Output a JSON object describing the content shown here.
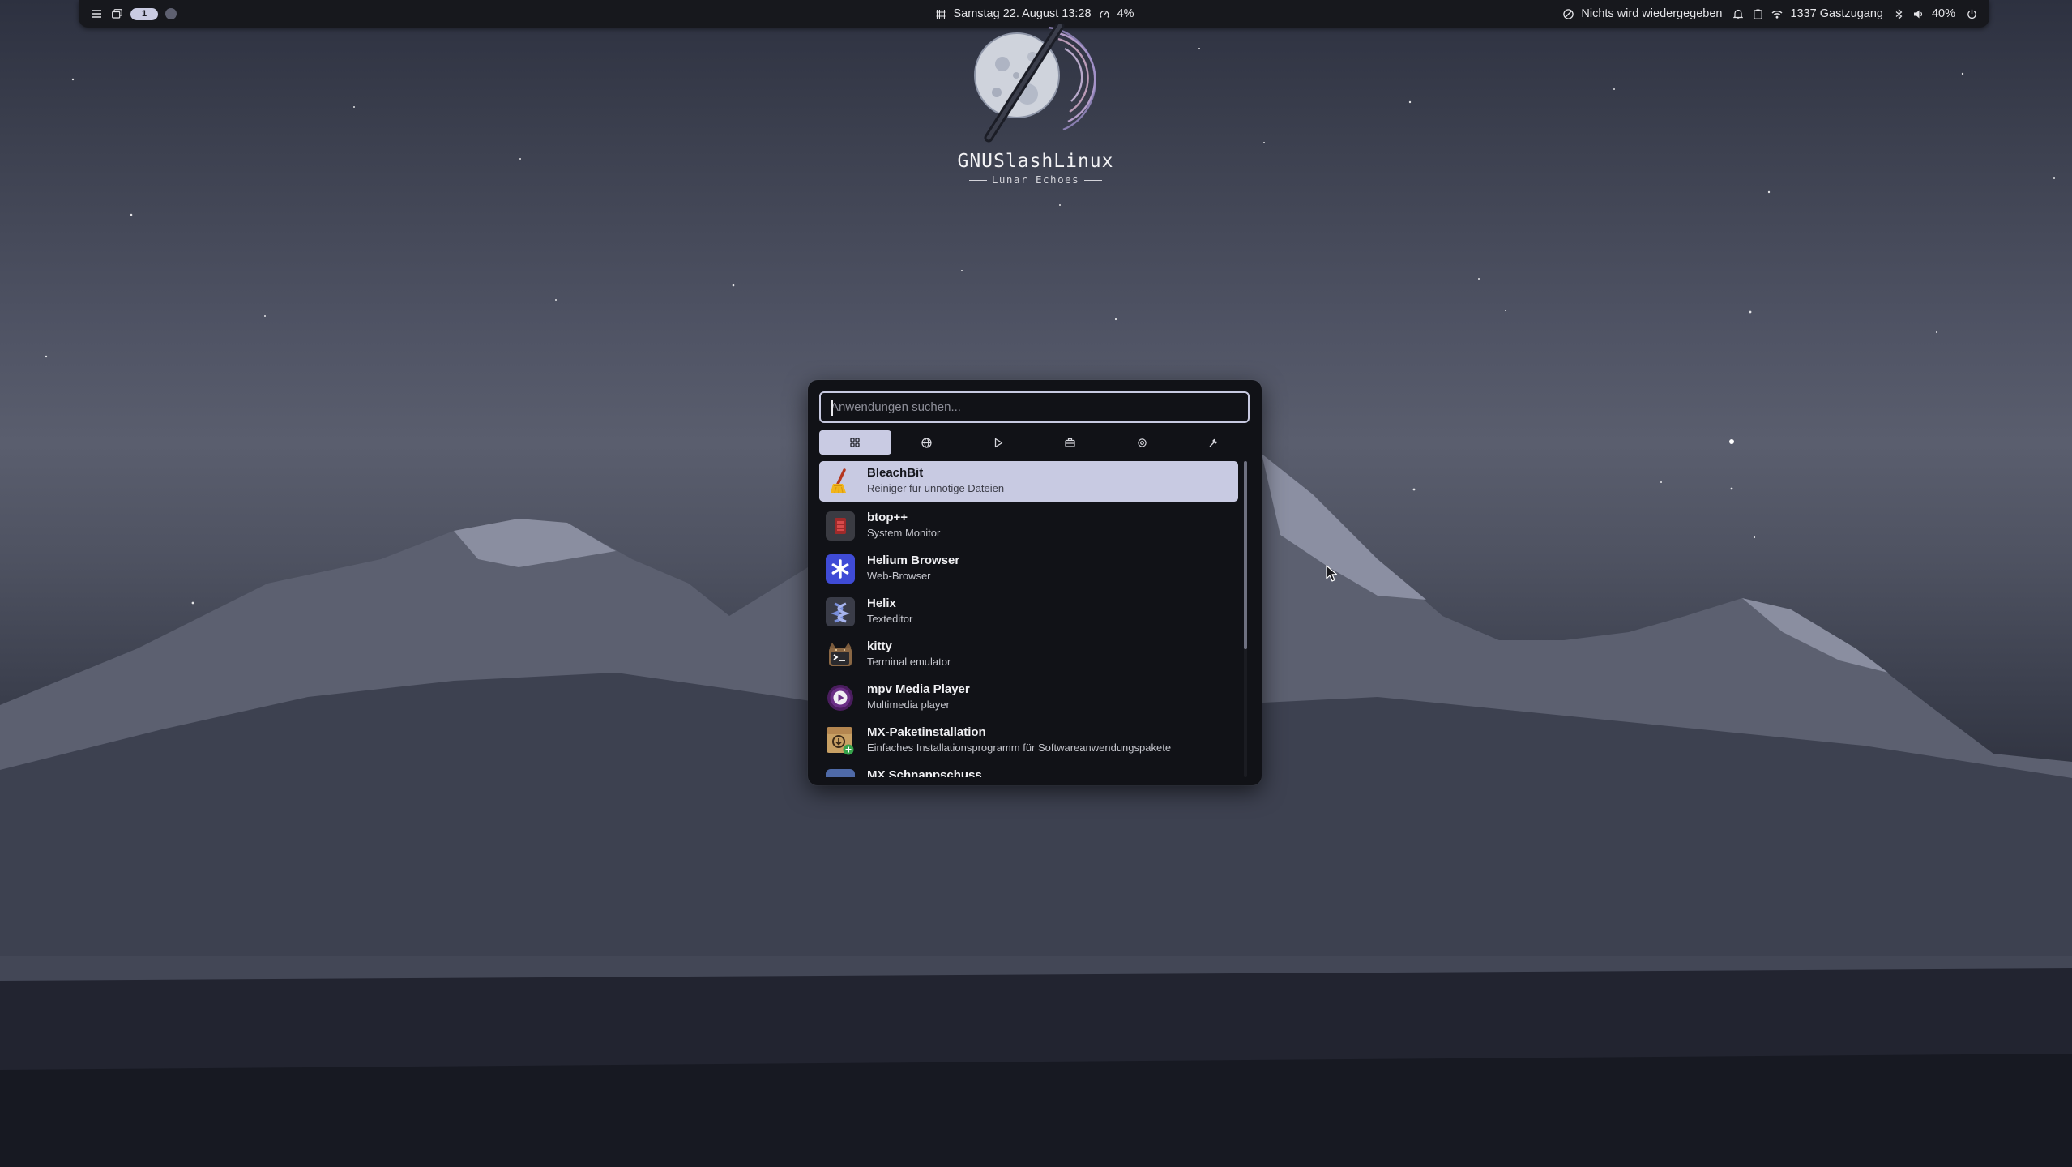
{
  "topbar": {
    "workspace": "1",
    "datetime": "Samstag 22. August 13:28",
    "cpu": "4%",
    "media": "Nichts wird wiedergegeben",
    "network": "1337 Gastzugang",
    "volume": "40%"
  },
  "logo": {
    "title": "GNUSlashLinux",
    "subtitle": "Lunar Echoes"
  },
  "launcher": {
    "search_placeholder": "Anwendungen suchen...",
    "categories": [
      {
        "icon": "grid-icon",
        "active": true
      },
      {
        "icon": "globe-icon",
        "active": false
      },
      {
        "icon": "play-icon",
        "active": false
      },
      {
        "icon": "toolbox-icon",
        "active": false
      },
      {
        "icon": "gear-icon",
        "active": false
      },
      {
        "icon": "wrench-icon",
        "active": false
      }
    ],
    "apps": [
      {
        "name": "BleachBit",
        "desc": "Reiniger für unnötige Dateien",
        "icon": "bleachbit-icon",
        "selected": true
      },
      {
        "name": "btop++",
        "desc": "System Monitor",
        "icon": "btop-icon"
      },
      {
        "name": "Helium Browser",
        "desc": "Web-Browser",
        "icon": "helium-icon"
      },
      {
        "name": "Helix",
        "desc": "Texteditor",
        "icon": "helix-icon"
      },
      {
        "name": "kitty",
        "desc": "Terminal emulator",
        "icon": "kitty-icon"
      },
      {
        "name": "mpv Media Player",
        "desc": "Multimedia player",
        "icon": "mpv-icon"
      },
      {
        "name": "MX-Paketinstallation",
        "desc": "Einfaches Installationsprogramm für Softwareanwendungspakete",
        "icon": "mx-package-icon"
      },
      {
        "name": "MX Schnappschuss",
        "desc": "",
        "icon": "mx-snapshot-icon"
      }
    ]
  }
}
